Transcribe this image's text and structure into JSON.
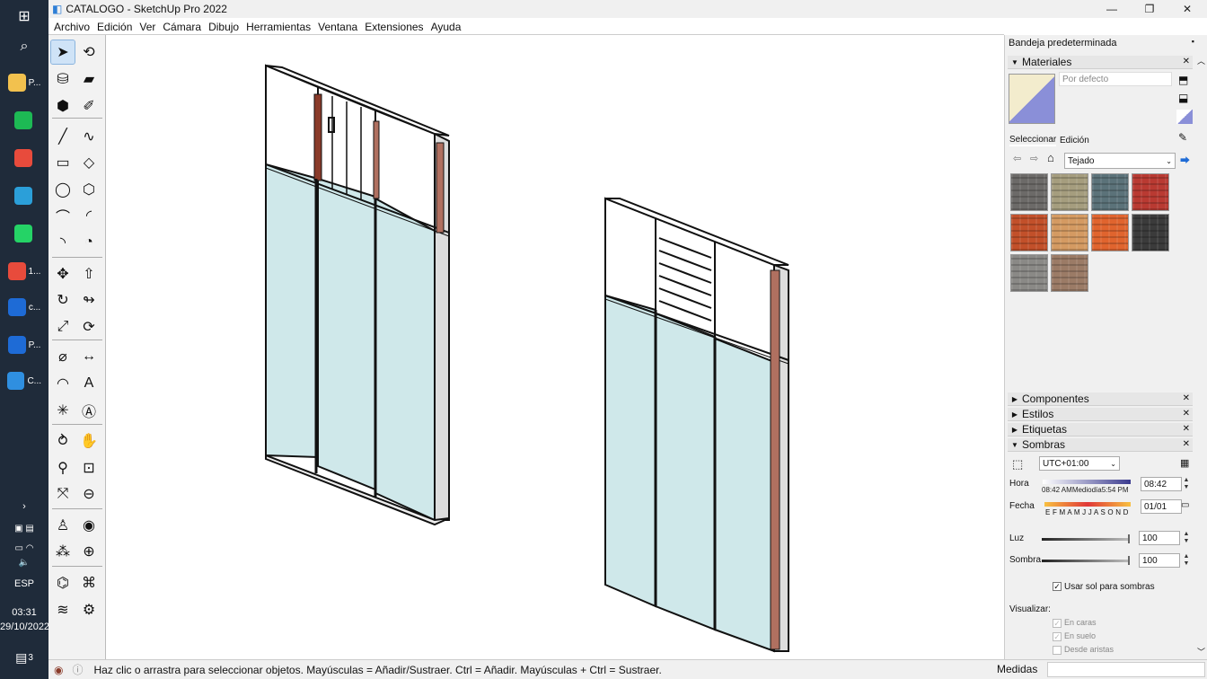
{
  "window": {
    "title": "CATALOGO - SketchUp Pro 2022",
    "minimize": "—",
    "maximize": "❐",
    "close": "✕"
  },
  "menu": [
    "Archivo",
    "Edición",
    "Ver",
    "Cámara",
    "Dibujo",
    "Herramientas",
    "Ventana",
    "Extensiones",
    "Ayuda"
  ],
  "taskbar": {
    "apps": [
      {
        "label": "P...",
        "icon": "folder-icon",
        "color": "#f2c14e"
      },
      {
        "label": "",
        "icon": "spotify-icon",
        "color": "#1db954"
      },
      {
        "label": "",
        "icon": "chrome-icon",
        "color": "#e84b3c"
      },
      {
        "label": "",
        "icon": "edge-icon",
        "color": "#2b9fd9"
      },
      {
        "label": "",
        "icon": "whatsapp-icon",
        "color": "#25d366"
      },
      {
        "label": "1...",
        "icon": "chrome-profile-icon",
        "color": "#e84b3c"
      },
      {
        "label": "c...",
        "icon": "app-c-icon",
        "color": "#1e6bd6"
      },
      {
        "label": "P...",
        "icon": "app-p-icon",
        "color": "#1e6bd6"
      },
      {
        "label": "C...",
        "icon": "sketchup-icon",
        "color": "#2f8fe0"
      }
    ],
    "lang": "ESP",
    "time": "03:31",
    "date": "29/10/2022",
    "notifications": "3"
  },
  "tray": {
    "title": "Bandeja predeterminada",
    "materials": {
      "header": "Materiales",
      "name_placeholder": "Por defecto",
      "tabs": [
        "Seleccionar",
        "Edición"
      ],
      "collection": "Tejado",
      "swatches": [
        "#6c6a68",
        "#a59d7e",
        "#5b7279",
        "#b93a32",
        "#c2502a",
        "#d49a62",
        "#e0642e",
        "#3b3b3b",
        "#8a8986",
        "#9b7b66"
      ]
    },
    "sections": [
      "Componentes",
      "Estilos",
      "Etiquetas"
    ],
    "shadows": {
      "header": "Sombras",
      "timezone": "UTC+01:00",
      "hora_label": "Hora",
      "hora_start": "08:42 AM",
      "hora_mid": "Mediodía",
      "hora_end": "5:54 PM",
      "hora_value": "08:42",
      "fecha_label": "Fecha",
      "months": "E F M A M J J A S O N D",
      "fecha_value": "01/01",
      "luz_label": "Luz",
      "luz_value": "100",
      "sombra_label": "Sombra",
      "sombra_value": "100",
      "use_sun": "Usar sol para sombras",
      "visualizar": "Visualizar:",
      "en_caras": "En caras",
      "en_suelo": "En suelo",
      "desde_aristas": "Desde aristas"
    }
  },
  "status": {
    "message": "Haz clic o arrastra para seleccionar objetos. Mayúsculas = Añadir/Sustraer. Ctrl = Añadir. Mayúsculas + Ctrl = Sustraer.",
    "measure_label": "Medidas"
  },
  "tools": [
    "select-tool",
    "orbit-tool",
    "paint-bucket-tool",
    "eraser-tool",
    "component-tool",
    "tag-tool",
    "line-tool",
    "freehand-tool",
    "rectangle-tool",
    "rotated-rectangle-tool",
    "circle-tool",
    "polygon-tool",
    "arc-tool",
    "two-point-arc-tool",
    "three-point-arc-tool",
    "pie-tool",
    "move-tool",
    "push-pull-tool",
    "rotate-tool",
    "follow-me-tool",
    "scale-tool",
    "offset-tool",
    "tape-measure-tool",
    "dimension-tool",
    "protractor-tool",
    "text-tool",
    "axes-tool",
    "3d-text-tool",
    "orbit-camera-tool",
    "pan-tool",
    "zoom-tool",
    "zoom-window-tool",
    "zoom-extents-tool",
    "previous-view-tool",
    "position-camera-tool",
    "look-around-tool",
    "walk-tool",
    "section-plane-tool",
    "sandbox-from-contours-tool",
    "sandbox-from-scratch-tool",
    "smoove-tool",
    "stamp-tool"
  ],
  "colors": {
    "selection": "#cfe3f7",
    "glass": "#cfe8ea",
    "frame": "#111111",
    "wood": "#8a3b2a"
  }
}
